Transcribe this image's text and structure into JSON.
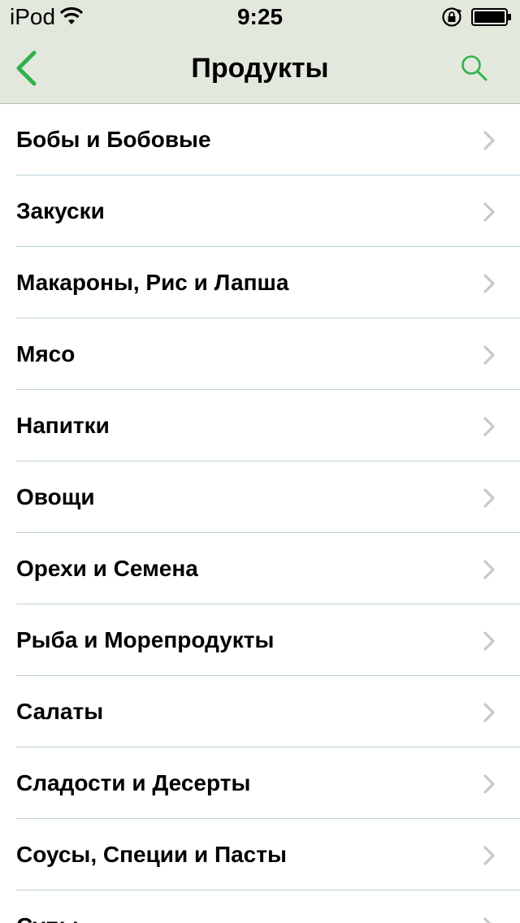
{
  "status_bar": {
    "carrier": "iPod",
    "time": "9:25"
  },
  "nav": {
    "title": "Продукты",
    "back_icon": "chevron-left-icon",
    "search_icon": "search-icon"
  },
  "colors": {
    "accent": "#2fb34a",
    "header_bg": "#e3e8dd",
    "separator": "#bcd1dd",
    "chevron": "#c7c7cc"
  },
  "categories": [
    {
      "label": "Бобы и Бобовые"
    },
    {
      "label": "Закуски"
    },
    {
      "label": "Макароны, Рис и Лапша"
    },
    {
      "label": "Мясо"
    },
    {
      "label": "Напитки"
    },
    {
      "label": "Овощи"
    },
    {
      "label": "Орехи и Семена"
    },
    {
      "label": "Рыба и Морепродукты"
    },
    {
      "label": "Салаты"
    },
    {
      "label": "Сладости и Десерты"
    },
    {
      "label": "Соусы, Специи и Пасты"
    },
    {
      "label": "Супы"
    }
  ]
}
